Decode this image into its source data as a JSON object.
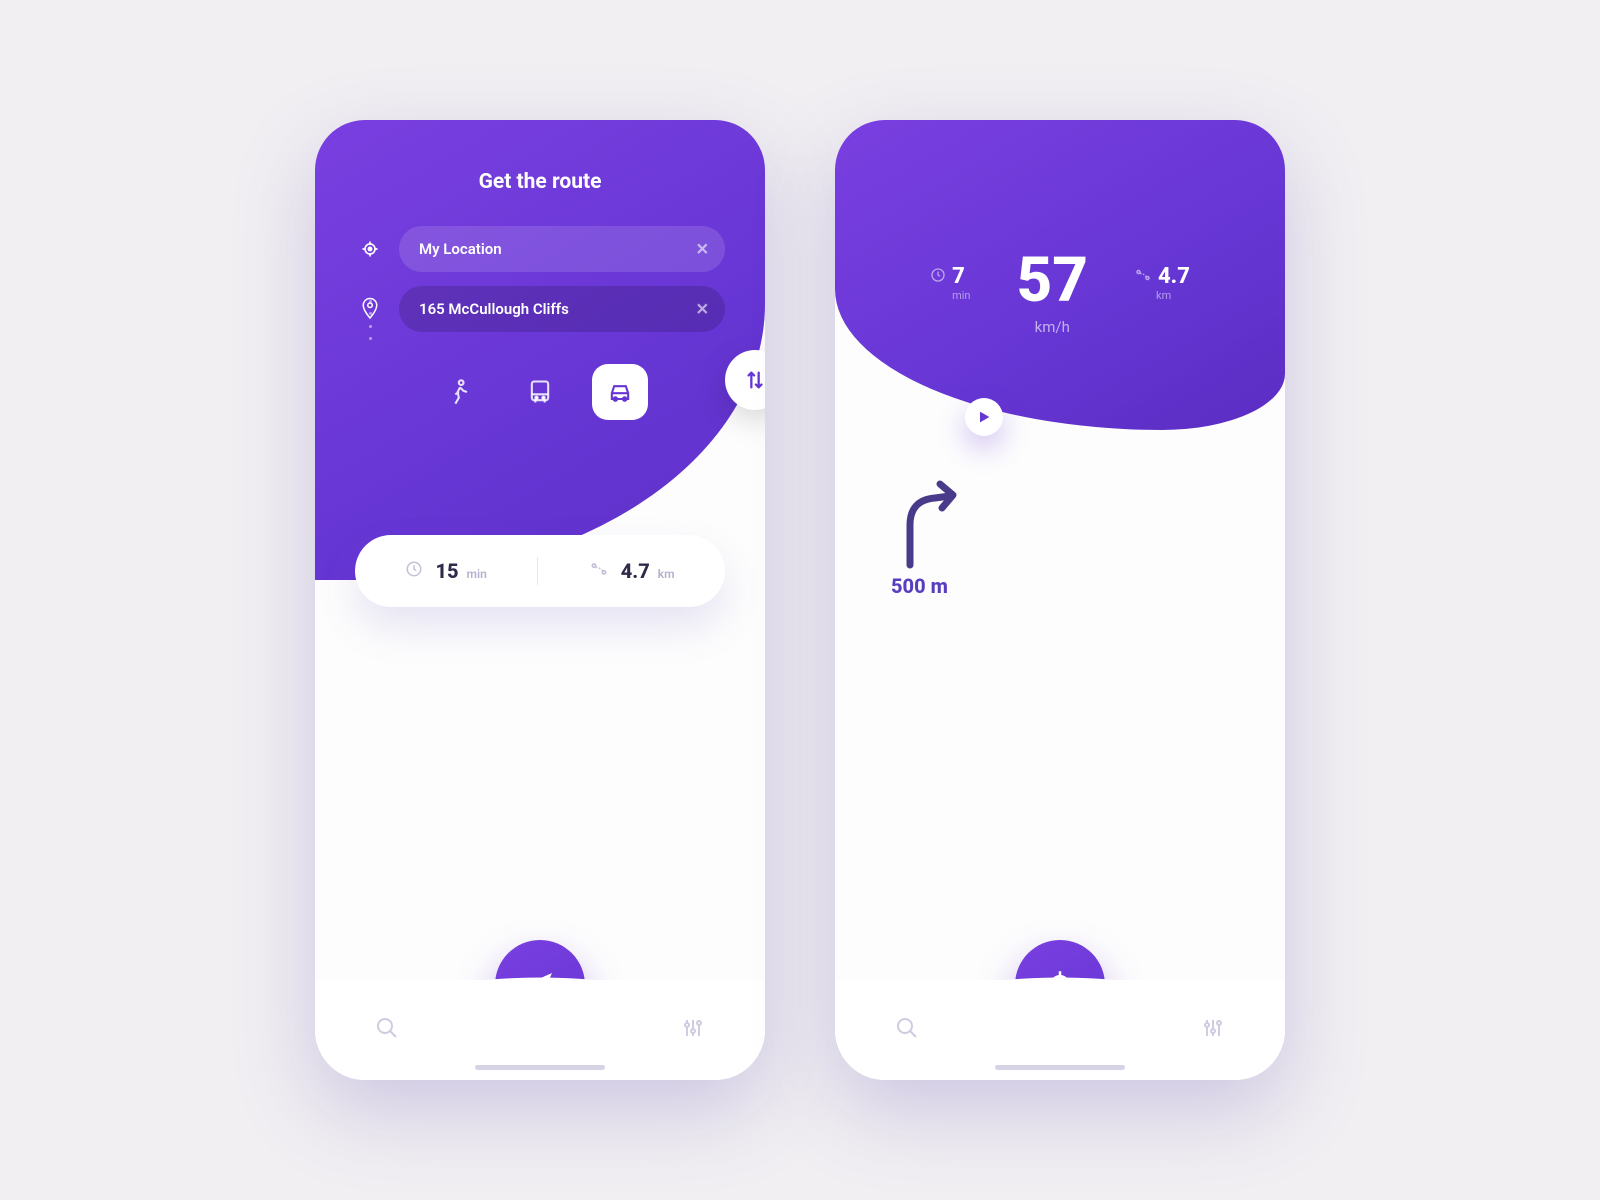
{
  "colors": {
    "primary": "#6636d4",
    "bg": "#f1eff2"
  },
  "screen1": {
    "title": "Get the route",
    "origin_label": "My Location",
    "destination_label": "165 McCullough Cliffs",
    "modes": {
      "walk": "walk",
      "bus": "bus",
      "car": "car",
      "selected": "car"
    },
    "stats": {
      "time_value": "15",
      "time_unit": "min",
      "distance_value": "4.7",
      "distance_unit": "km"
    }
  },
  "screen2": {
    "time_value": "7",
    "time_unit": "min",
    "speed_value": "57",
    "speed_unit": "km/h",
    "distance_value": "4.7",
    "distance_unit": "km",
    "next_turn_distance": "500 m"
  }
}
